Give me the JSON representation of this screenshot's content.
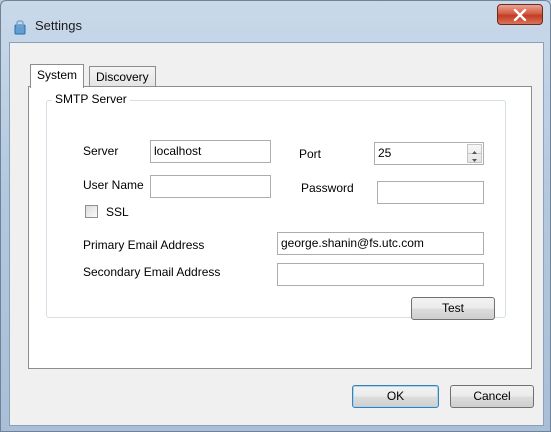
{
  "window": {
    "title": "Settings",
    "close_label": "close"
  },
  "tabs": [
    {
      "label": "System",
      "selected": true
    },
    {
      "label": "Discovery",
      "selected": false
    }
  ],
  "smtp": {
    "group_title": "SMTP Server",
    "server_label": "Server",
    "server_value": "localhost",
    "port_label": "Port",
    "port_value": "25",
    "username_label": "User Name",
    "username_value": "",
    "password_label": "Password",
    "password_value": "",
    "ssl_label": "SSL",
    "ssl_checked": false,
    "primary_email_label": "Primary Email Address",
    "primary_email_value": "george.shanin@fs.utc.com",
    "secondary_email_label": "Secondary Email Address",
    "secondary_email_value": "",
    "test_button": "Test"
  },
  "footer": {
    "ok_button": "OK",
    "cancel_button": "Cancel"
  },
  "icons": {
    "title": "settings-window-icon",
    "close": "close-icon",
    "spin_up": "arrow-up-icon",
    "spin_down": "arrow-down-icon"
  }
}
